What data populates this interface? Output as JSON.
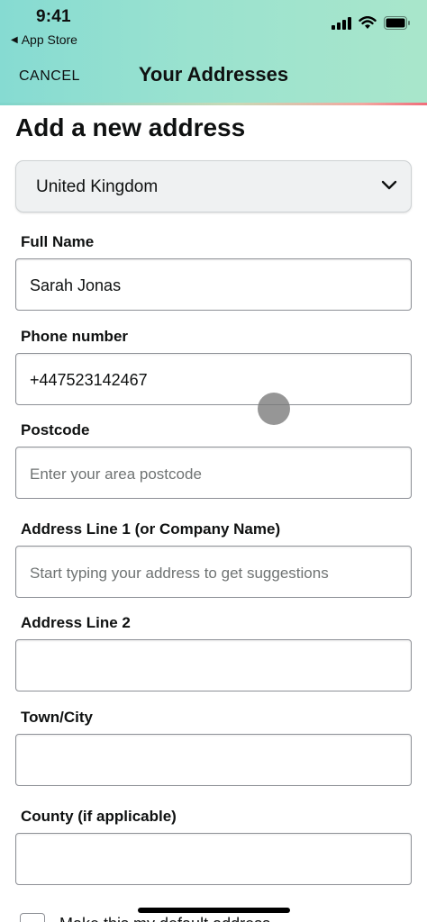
{
  "status_bar": {
    "time": "9:41",
    "back_app": "App Store"
  },
  "nav": {
    "cancel_label": "CANCEL",
    "title": "Your Addresses"
  },
  "page": {
    "title": "Add a new address"
  },
  "country_select": {
    "value": "United Kingdom"
  },
  "form": {
    "full_name": {
      "label": "Full Name",
      "value": "Sarah Jonas"
    },
    "phone": {
      "label": "Phone number",
      "value": "+447523142467"
    },
    "postcode": {
      "label": "Postcode",
      "placeholder": "Enter your area postcode"
    },
    "address1": {
      "label": "Address Line 1 (or Company Name)",
      "placeholder": "Start typing your address to get suggestions"
    },
    "address2": {
      "label": "Address Line 2"
    },
    "town": {
      "label": "Town/City"
    },
    "county": {
      "label": "County (if applicable)"
    },
    "default_checkbox": {
      "label": "Make this my default address",
      "checked": false
    }
  },
  "colors": {
    "header_gradient_start": "#86dbd2",
    "header_gradient_end": "#a9e6cb",
    "text": "#0f1111",
    "placeholder": "#6f7373",
    "field_border": "#8d9096"
  }
}
